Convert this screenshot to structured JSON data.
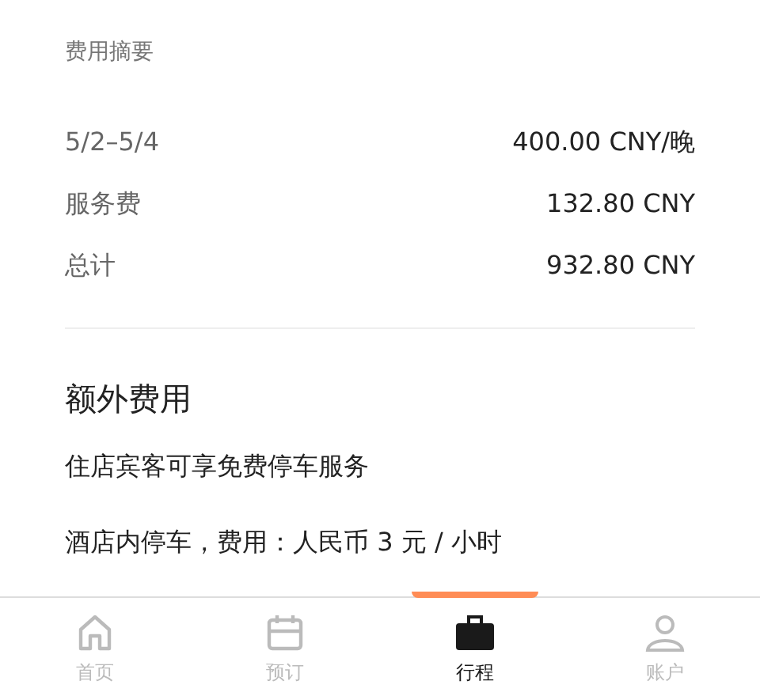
{
  "summary": {
    "title": "费用摘要",
    "rows": [
      {
        "label": "5/2–5/4",
        "value": "400.00 CNY/晚"
      },
      {
        "label": "服务费",
        "value": "132.80 CNY"
      },
      {
        "label": "总计",
        "value": "932.80 CNY"
      }
    ]
  },
  "extra_fees": {
    "title": "额外费用",
    "lines": [
      "住店宾客可享免费停车服务",
      "酒店内停车，费用：人民币 3 元 / 小时"
    ]
  },
  "tab_bar": [
    {
      "kind": "home",
      "label": "首页",
      "selected": false
    },
    {
      "kind": "calendar",
      "label": "预订",
      "selected": false
    },
    {
      "kind": "briefcase",
      "label": "行程",
      "selected": true
    },
    {
      "kind": "person",
      "label": "账户",
      "selected": false
    }
  ]
}
